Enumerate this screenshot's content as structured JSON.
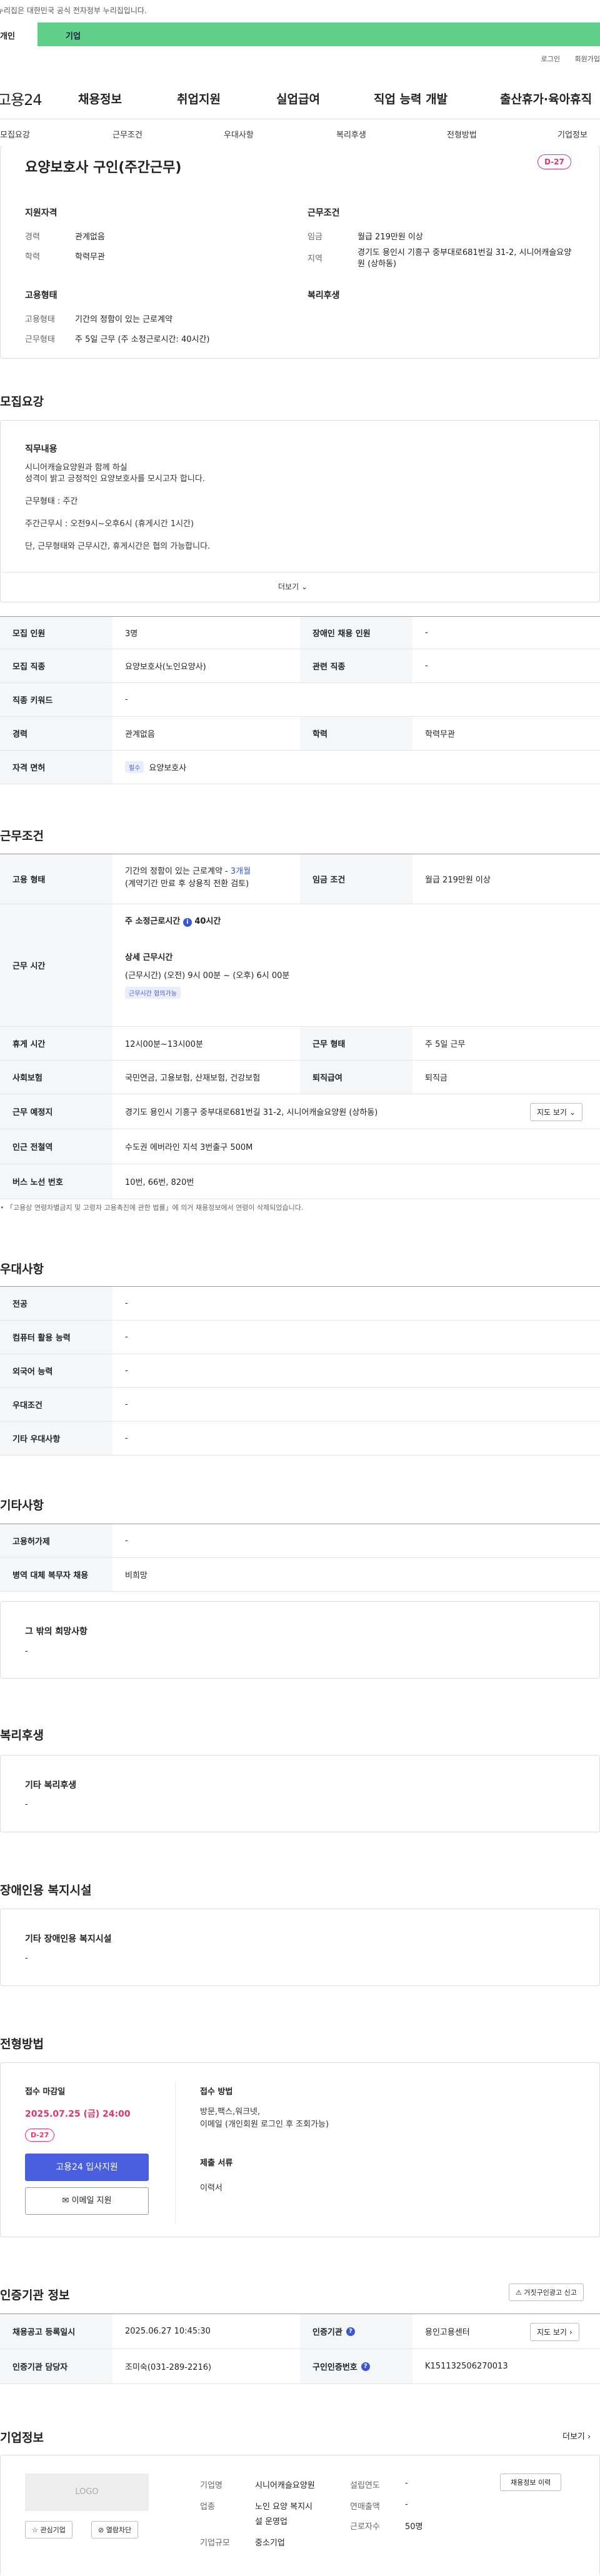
{
  "notice": "이 누리집은 대한민국 공식 전자정부 누리집입니다.",
  "typebar": {
    "personal": "개인",
    "company": "기업"
  },
  "util": {
    "login": "로그인",
    "join": "회원가입"
  },
  "gnb": {
    "logo": "고용24",
    "menus": [
      "채용정보",
      "취업지원",
      "실업급여",
      "직업 능력 개발",
      "출산휴가·육아휴직"
    ]
  },
  "tabs": [
    "모집요강",
    "근무조건",
    "우대사항",
    "복리후생",
    "전형방법",
    "기업정보"
  ],
  "job": {
    "title": "요양보호사 구인(주간근무)",
    "dday": "D-27"
  },
  "summary": {
    "qual_h": "지원자격",
    "cond_h": "근무조건",
    "emp_h": "고용형태",
    "welfare_h": "복리후생",
    "career_k": "경력",
    "career_v": "관계없음",
    "edu_k": "학력",
    "edu_v": "학력무관",
    "wage_k": "임금",
    "wage_v": "월급 219만원 이상",
    "region_k": "지역",
    "region_v": "경기도 용인시 기흥구 중부대로681번길 31-2, 시니어캐슬요양원 (상하동)",
    "emptype_k": "고용형태",
    "emptype_v": "기간의 정함이 있는 근로계약",
    "worktype_k": "근무형태",
    "worktype_v": "주 5일 근무 (주 소정근로시간: 40시간)"
  },
  "recruit": {
    "h": "모집요강",
    "duty_h": "직무내용",
    "duty_lines": [
      "시니어캐슬요양원과 함께 하실",
      "성격이 밝고 긍정적인 요양보호사를 모시고자 합니다.",
      "근무형태 : 주간",
      "주간근무시 : 오전9시~오후6시 (휴게시간 1시간)",
      "단, 근무형태와 근무시간, 휴게시간은 협의 가능합니다."
    ],
    "more": "더보기",
    "rows": [
      {
        "k1": "모집 인원",
        "v1": "3명",
        "k2": "장애인 채용 인원",
        "v2": "-"
      },
      {
        "k1": "모집 직종",
        "v1": "요양보호사(노인요양사)",
        "k2": "관련 직종",
        "v2": "-"
      },
      {
        "k1": "직종 키워드",
        "v1": "-"
      },
      {
        "k1": "경력",
        "v1": "관계없음",
        "k2": "학력",
        "v2": "학력무관"
      },
      {
        "k1": "자격 면허",
        "chip": "필수",
        "v1": "요양보호사"
      }
    ]
  },
  "cond": {
    "h": "근무조건",
    "emp_k": "고용 형태",
    "emp_v1": "기간의 정함이 있는 근로계약 -",
    "emp_v1b": "3개월",
    "emp_v2": "(계약기간 만료 후 상용직 전환 검토)",
    "wage_k": "임금 조건",
    "wage_v": "월급 219만원 이상",
    "time_k": "근무 시간",
    "time_a": "주 소정근로시간",
    "time_a2": "40시간",
    "time_b": "상세 근무시간",
    "time_c": "(근무시간) (오전) 9시 00분 ~ (오후) 6시 00분",
    "time_chip": "근무시간 협의가능",
    "rest_k": "휴게 시간",
    "rest_v": "12시00분~13시00분",
    "form_k": "근무 형태",
    "form_v": "주 5일 근무",
    "ins_k": "사회보험",
    "ins_v": "국민연금, 고용보험, 산재보험, 건강보험",
    "ret_k": "퇴직급여",
    "ret_v": "퇴직금",
    "place_k": "근무 예정지",
    "place_v": "경기도 용인시 기흥구 중부대로681번길 31-2, 시니어캐슬요양원 (상하동)",
    "map": "지도 보기",
    "sub_k": "인근 전철역",
    "sub_v": "수도권 에버라인 지석 3번출구 500M",
    "bus_k": "버스 노선 번호",
    "bus_v": "10번, 66번, 820번",
    "foot": "「고용상 연령차별금지 및 고령자 고용촉진에 관한 법률」에 의거 채용정보에서 연령이 삭제되었습니다."
  },
  "pref": {
    "h": "우대사항",
    "rows": [
      {
        "k": "전공",
        "v": "-"
      },
      {
        "k": "컴퓨터 활용 능력",
        "v": "-"
      },
      {
        "k": "외국어 능력",
        "v": "-"
      },
      {
        "k": "우대조건",
        "v": "-"
      },
      {
        "k": "기타 우대사항",
        "v": "-"
      }
    ]
  },
  "etc": {
    "h": "기타사항",
    "rows": [
      {
        "k": "고용허가제",
        "v": "-"
      },
      {
        "k": "병역 대체 복무자 채용",
        "v": "비희망"
      }
    ],
    "other_h": "그 밖의 희망사항",
    "other_v": "-"
  },
  "welfare": {
    "h": "복리후생",
    "box_h": "기타 복리후생",
    "box_v": "-"
  },
  "disab": {
    "h": "장애인용 복지시설",
    "box_h": "기타 장애인용 복지시설",
    "box_v": "-"
  },
  "process": {
    "h": "전형방법",
    "deadline_h": "접수 마감일",
    "deadline": "2025.07.25 (금) 24:00",
    "dday": "D-27",
    "apply": "고용24 입사지원",
    "email": "이메일 지원",
    "method_h": "접수 방법",
    "method_v1": "방문,팩스,워크넷,",
    "method_v2": "이메일 (개인회원 로그인 후 조회가능)",
    "docs_h": "제출 서류",
    "docs_v": "이력서"
  },
  "cert": {
    "h": "인증기관 정보",
    "report": "거짓구인광고 신고",
    "reg_k": "채용공고 등록일시",
    "reg_v": "2025.06.27 10:45:30",
    "org_k": "인증기관",
    "org_v": "용인고용센터",
    "map": "지도 보기",
    "mgr_k": "인증기관 담당자",
    "mgr_v": "조미숙(031-289-2216)",
    "num_k": "구인인증번호",
    "num_v": "K151132506270013"
  },
  "company": {
    "h": "기업정보",
    "more": "더보기",
    "logo": "LOGO",
    "fav": "관심기업",
    "block": "열람차단",
    "name_k": "기업명",
    "name_v": "시니어캐슬요양원",
    "ind_k": "업종",
    "ind_v1": "노인 요양 복지시",
    "ind_v2": "설 운영업",
    "size_k": "기업규모",
    "size_v": "중소기업",
    "est_k": "설립연도",
    "est_v": "-",
    "sales_k": "연매출액",
    "sales_v": "-",
    "emp_k": "근로자수",
    "emp_v": "50명",
    "jobs_btn": "채용정보 이력"
  }
}
